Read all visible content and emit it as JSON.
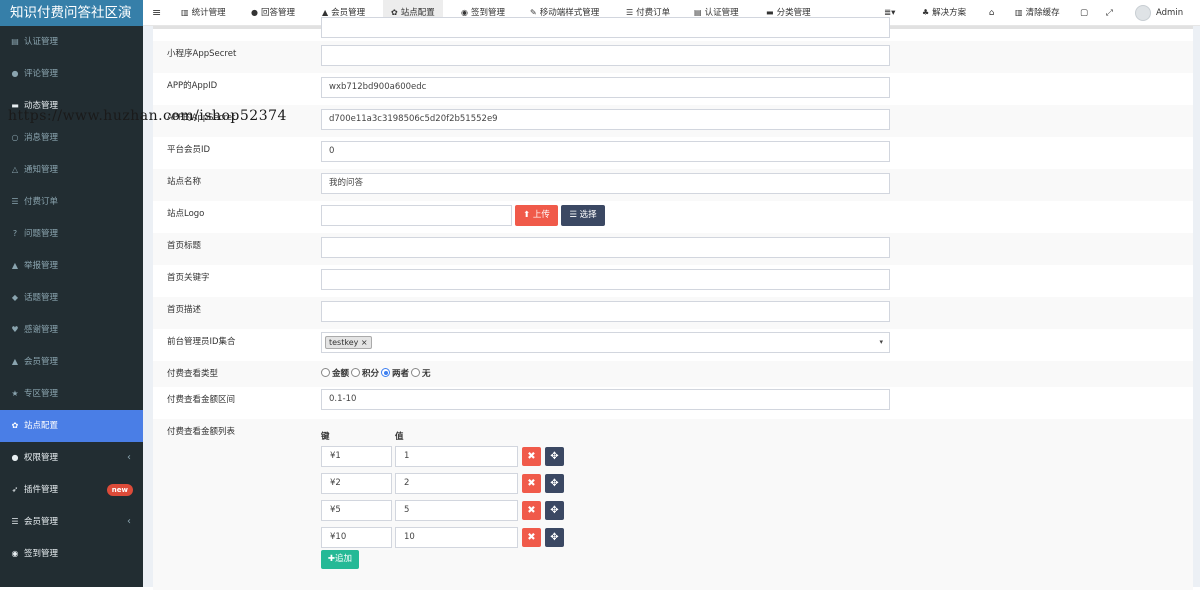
{
  "app": {
    "title": "知识付费问答社区演"
  },
  "watermark": "https://www.huzhan.com/ishop52374",
  "colors": {
    "primary": "#4a7ee6",
    "danger": "#f05a4a",
    "dark": "#3b4863",
    "success": "#25b996"
  },
  "sidebar": {
    "items": [
      {
        "label": "认证管理",
        "icon": "id-card-icon",
        "glyph": "▤"
      },
      {
        "label": "评论管理",
        "icon": "comments-icon",
        "glyph": "●"
      },
      {
        "label": "动态管理",
        "icon": "laptop-icon",
        "glyph": "▬"
      },
      {
        "label": "消息管理",
        "icon": "comment-icon",
        "glyph": "○"
      },
      {
        "label": "通知管理",
        "icon": "bell-icon",
        "glyph": "△"
      },
      {
        "label": "付费订单",
        "icon": "list-icon",
        "glyph": "☰"
      },
      {
        "label": "问题管理",
        "icon": "question-circle-icon",
        "glyph": "?"
      },
      {
        "label": "举报管理",
        "icon": "warning-icon",
        "glyph": "▲"
      },
      {
        "label": "话题管理",
        "icon": "tag-icon",
        "glyph": "◆"
      },
      {
        "label": "感谢管理",
        "icon": "heart-icon",
        "glyph": "♥"
      },
      {
        "label": "会员管理",
        "icon": "user-icon",
        "glyph": "▲"
      },
      {
        "label": "专区管理",
        "icon": "star-icon",
        "glyph": "★"
      },
      {
        "label": "站点配置",
        "icon": "cogs-icon",
        "glyph": "✿"
      },
      {
        "label": "权限管理",
        "icon": "group-icon",
        "glyph": "●",
        "chevron": "‹"
      },
      {
        "label": "插件管理",
        "icon": "rocket-icon",
        "glyph": "➶",
        "badge": "new"
      },
      {
        "label": "会员管理",
        "icon": "list-alt-icon",
        "glyph": "☰",
        "chevron": "‹"
      },
      {
        "label": "签到管理",
        "icon": "map-marker-icon",
        "glyph": "◉"
      }
    ]
  },
  "topbar": {
    "items": [
      {
        "label": "统计管理",
        "icon": "bar-chart-icon",
        "glyph": "▥"
      },
      {
        "label": "回答管理",
        "icon": "comment-icon",
        "glyph": "●"
      },
      {
        "label": "会员管理",
        "icon": "user-icon",
        "glyph": "▲"
      },
      {
        "label": "站点配置",
        "icon": "cogs-icon",
        "glyph": "✿"
      },
      {
        "label": "签到管理",
        "icon": "map-marker-icon",
        "glyph": "◉"
      },
      {
        "label": "移动端样式管理",
        "icon": "magic-icon",
        "glyph": "✎"
      },
      {
        "label": "付费订单",
        "icon": "list-icon",
        "glyph": "☰"
      },
      {
        "label": "认证管理",
        "icon": "id-card-icon",
        "glyph": "▤"
      },
      {
        "label": "分类管理",
        "icon": "folder-icon",
        "glyph": "▬"
      }
    ],
    "menu_toggle": "≡",
    "right": {
      "list_glyph": "≣▾",
      "solution": "解决方案",
      "solution_glyph": "♣",
      "home_glyph": "⌂",
      "clear_cache": "清除缓存",
      "clear_glyph": "▥",
      "lang_glyph": "▢",
      "fullscreen_glyph": "⤢",
      "user": "Admin"
    }
  },
  "form": {
    "fields": {
      "mini_app_secret": {
        "label": "小程序AppSecret",
        "value": ""
      },
      "app_id": {
        "label": "APP的AppID",
        "value": "wxb712bd900a600edc"
      },
      "app_secret": {
        "label": "APP的AppSecret",
        "value": "d700e11a3c3198506c5d20f2b51552e9"
      },
      "platform_member_id": {
        "label": "平台会员ID",
        "value": "0"
      },
      "site_name": {
        "label": "站点名称",
        "value": "我的问答"
      },
      "site_logo": {
        "label": "站点Logo",
        "value": "",
        "upload_label": "上传",
        "upload_glyph": "⬆",
        "select_label": "选择",
        "select_glyph": "☰"
      },
      "home_title": {
        "label": "首页标题",
        "value": ""
      },
      "home_keywords": {
        "label": "首页关键字",
        "value": ""
      },
      "home_description": {
        "label": "首页描述",
        "value": ""
      },
      "admin_ids": {
        "label": "前台管理员ID集合",
        "tag": "testkey",
        "tag_remove": "×",
        "caret": "▾"
      },
      "pay_view_type": {
        "label": "付费查看类型",
        "options": [
          "金额",
          "积分",
          "两者",
          "无"
        ],
        "selected": "两者"
      },
      "pay_view_range": {
        "label": "付费查看金额区间",
        "value": "0.1-10"
      },
      "pay_view_list": {
        "label": "付费查看金额列表",
        "key_header": "键",
        "value_header": "值",
        "rows": [
          {
            "key": "¥1",
            "value": "1"
          },
          {
            "key": "¥2",
            "value": "2"
          },
          {
            "key": "¥5",
            "value": "5"
          },
          {
            "key": "¥10",
            "value": "10"
          }
        ],
        "remove_glyph": "✖",
        "move_glyph": "✥",
        "add_label": "追加",
        "add_glyph": "✚"
      }
    }
  }
}
